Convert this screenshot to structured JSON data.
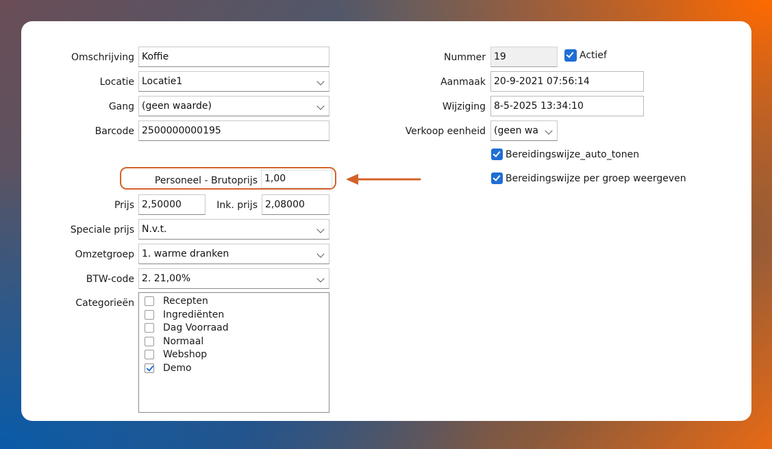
{
  "form": {
    "omschrijving": {
      "label": "Omschrijving",
      "value": "Koffie"
    },
    "locatie": {
      "label": "Locatie",
      "value": "Locatie1"
    },
    "gang": {
      "label": "Gang",
      "value": "(geen waarde)"
    },
    "barcode": {
      "label": "Barcode",
      "value": "2500000000195"
    },
    "personeel_brutoprijs": {
      "label": "Personeel - Brutoprijs",
      "value": "1,00"
    },
    "prijs": {
      "label": "Prijs",
      "value": "2,50000"
    },
    "ink_prijs": {
      "label": "Ink. prijs",
      "value": "2,08000"
    },
    "speciale_prijs": {
      "label": "Speciale prijs",
      "value": "N.v.t."
    },
    "omzetgroep": {
      "label": "Omzetgroep",
      "value": "1. warme dranken"
    },
    "btw_code": {
      "label": "BTW-code",
      "value": "2. 21,00%"
    },
    "categorieen": {
      "label": "Categorieën",
      "items": [
        {
          "label": "Recepten",
          "checked": false
        },
        {
          "label": "Ingrediënten",
          "checked": false
        },
        {
          "label": "Dag Voorraad",
          "checked": false
        },
        {
          "label": "Normaal",
          "checked": false
        },
        {
          "label": "Webshop",
          "checked": false
        },
        {
          "label": "Demo",
          "checked": true
        }
      ]
    },
    "nummer": {
      "label": "Nummer",
      "value": "19"
    },
    "actief": {
      "label": "Actief",
      "checked": true
    },
    "aanmaak": {
      "label": "Aanmaak",
      "value": "20-9-2021 07:56:14"
    },
    "wijziging": {
      "label": "Wijziging",
      "value": "8-5-2025 13:34:10"
    },
    "verkoop_eenheid": {
      "label": "Verkoop eenheid",
      "value": "(geen wa"
    },
    "bereidingswijze_auto_tonen": {
      "label": "Bereidingswijze_auto_tonen",
      "checked": true
    },
    "bereidingswijze_per_groep": {
      "label": "Bereidingswijze per groep weergeven",
      "checked": true
    }
  },
  "colors": {
    "highlight": "#d4622a",
    "checkbox_accent": "#1f6ed4"
  },
  "icons": {
    "dropdown": "chevron-down-icon",
    "annotation": "arrow-left-icon"
  }
}
